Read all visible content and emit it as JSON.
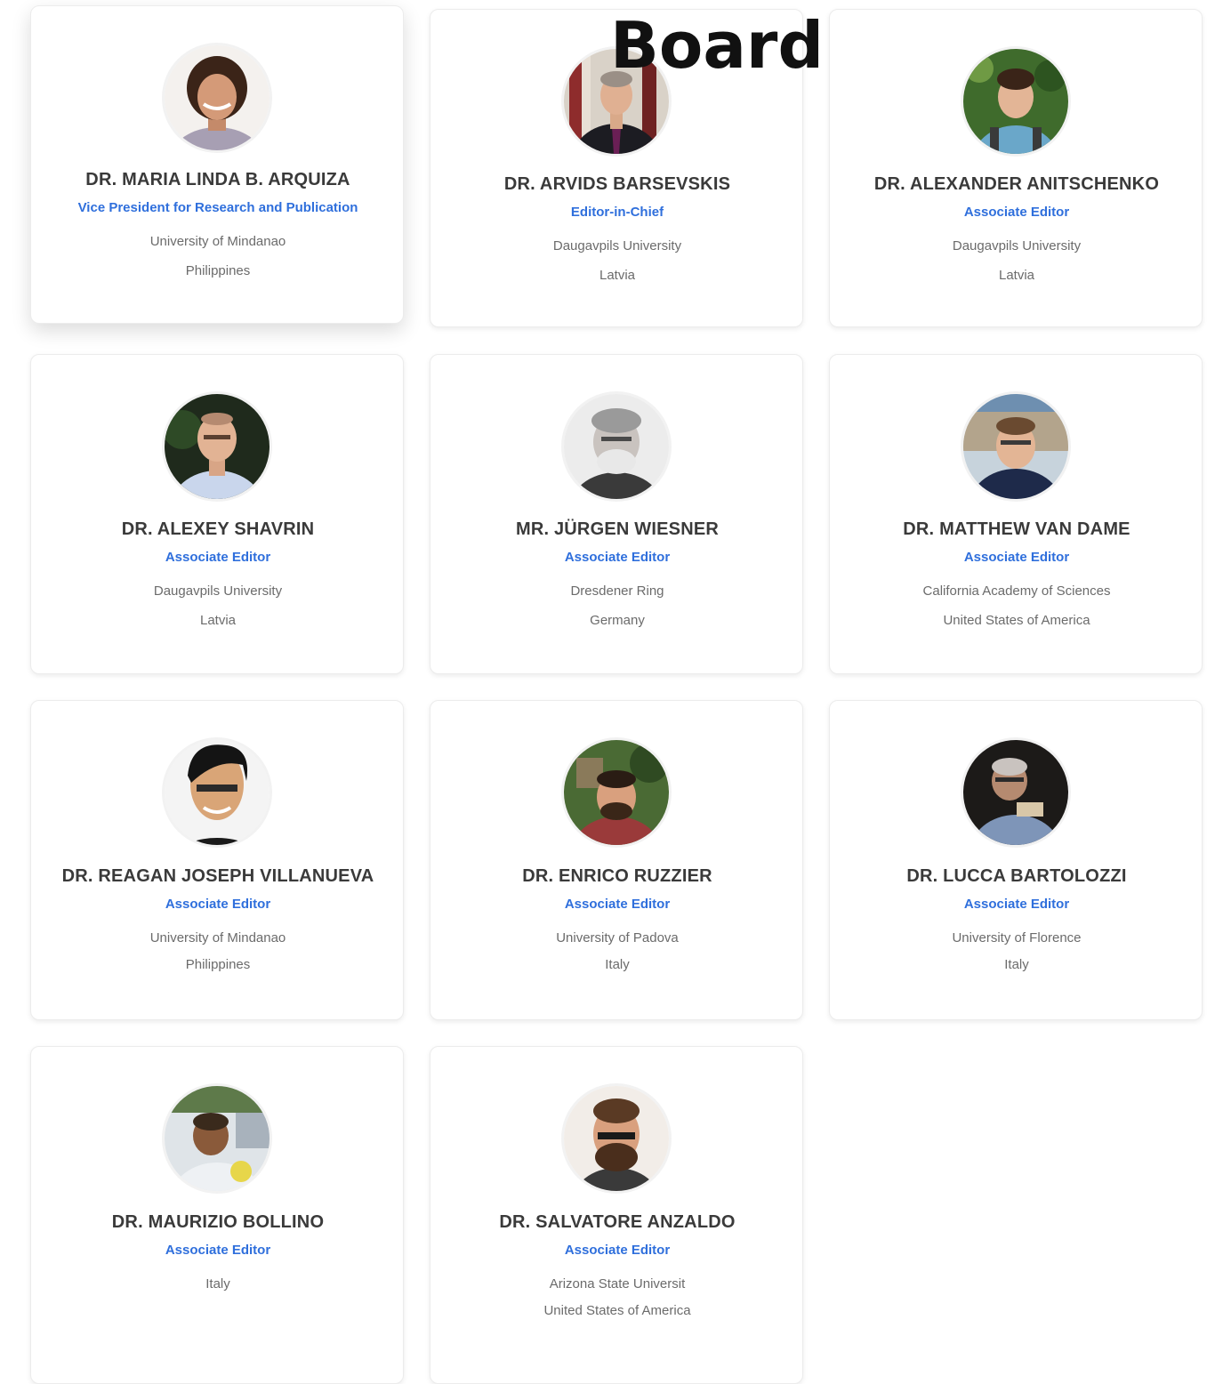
{
  "page": {
    "overlay_title": "Board"
  },
  "colors": {
    "accent": "#2f6fdc",
    "name_text": "#3a3a3a",
    "muted_text": "#6b6b6b"
  },
  "members": [
    {
      "name": "DR. MARIA LINDA B. ARQUIZA",
      "role": "Vice President for Research and Publication",
      "institution": "University of Mindanao",
      "country": "Philippines"
    },
    {
      "name": "DR. ARVIDS BARSEVSKIS",
      "role": "Editor-in-Chief",
      "institution": "Daugavpils University",
      "country": "Latvia"
    },
    {
      "name": "DR. ALEXANDER ANITSCHENKO",
      "role": "Associate Editor",
      "institution": "Daugavpils University",
      "country": "Latvia"
    },
    {
      "name": "DR. ALEXEY SHAVRIN",
      "role": "Associate Editor",
      "institution": "Daugavpils University",
      "country": "Latvia"
    },
    {
      "name": "MR. JÜRGEN WIESNER",
      "role": "Associate Editor",
      "institution": "Dresdener Ring",
      "country": "Germany"
    },
    {
      "name": "DR. MATTHEW VAN DAME",
      "role": "Associate Editor",
      "institution": "California Academy of Sciences",
      "country": "United States of America"
    },
    {
      "name": "DR. REAGAN JOSEPH VILLANUEVA",
      "role": "Associate Editor",
      "institution": "University of Mindanao",
      "country": "Philippines"
    },
    {
      "name": "DR. ENRICO RUZZIER",
      "role": "Associate Editor",
      "institution": "University of Padova",
      "country": "Italy"
    },
    {
      "name": "DR. LUCCA BARTOLOZZI",
      "role": "Associate Editor",
      "institution": "University of Florence",
      "country": "Italy"
    },
    {
      "name": "DR. MAURIZIO BOLLINO",
      "role": "Associate Editor",
      "institution": "",
      "country": "Italy"
    },
    {
      "name": "DR. SALVATORE ANZALDO",
      "role": "Associate Editor",
      "institution": "Arizona State Universit",
      "country": "United States of America"
    }
  ]
}
